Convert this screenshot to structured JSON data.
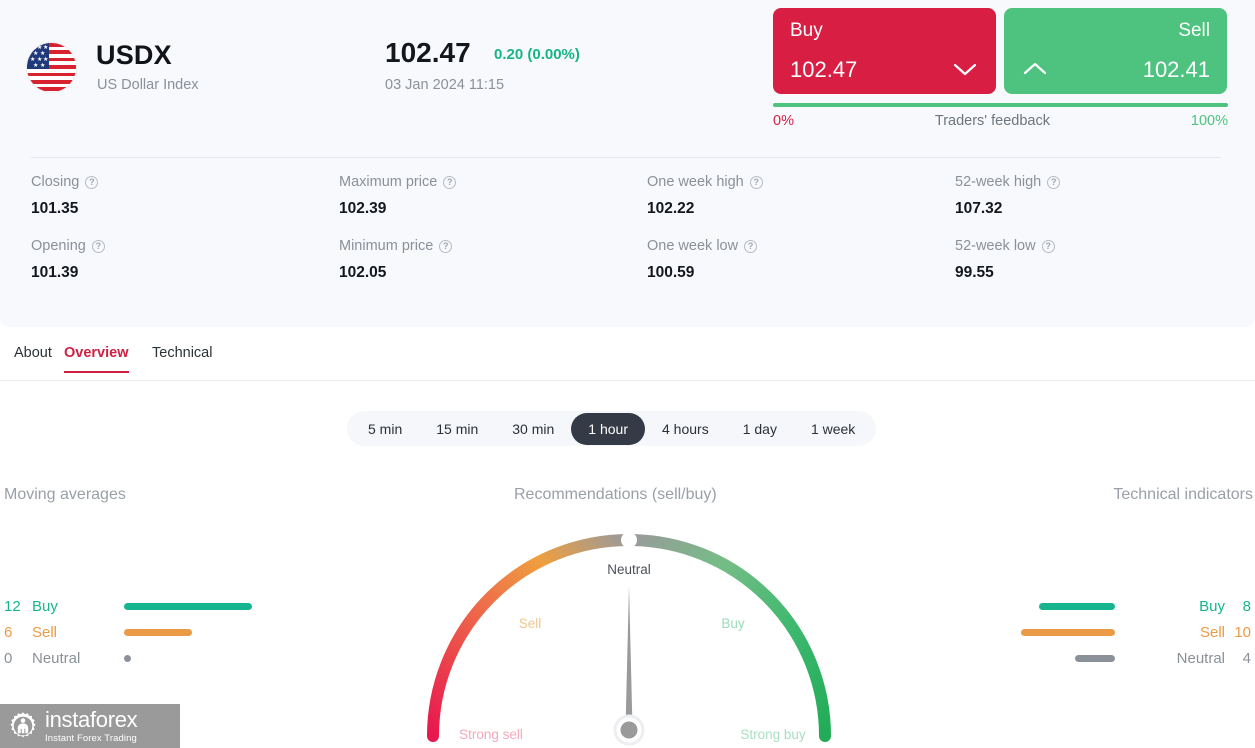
{
  "instrument": {
    "flag_icon": "us-flag-icon",
    "symbol": "USDX",
    "description": "US Dollar Index",
    "price": "102.47",
    "change": "0.20 (0.00%)",
    "timestamp": "03 Jan 2024 11:15"
  },
  "trade": {
    "buy_label": "Buy",
    "buy_price": "102.47",
    "sell_label": "Sell",
    "sell_price": "102.41",
    "buy_color": "#d81e43",
    "sell_color": "#4ec37f",
    "feedback_left": "0%",
    "feedback_title": "Traders' feedback",
    "feedback_right": "100%",
    "feedback_percent": 100
  },
  "stats": [
    {
      "label": "Closing",
      "value": "101.35"
    },
    {
      "label": "Maximum price",
      "value": "102.39"
    },
    {
      "label": "One week high",
      "value": "102.22"
    },
    {
      "label": "52-week high",
      "value": "107.32"
    },
    {
      "label": "Opening",
      "value": "101.39"
    },
    {
      "label": "Minimum price",
      "value": "102.05"
    },
    {
      "label": "One week low",
      "value": "100.59"
    },
    {
      "label": "52-week low",
      "value": "99.55"
    }
  ],
  "tabs": [
    {
      "label": "About",
      "active": false
    },
    {
      "label": "Overview",
      "active": true
    },
    {
      "label": "Technical",
      "active": false
    }
  ],
  "timeframes": [
    {
      "label": "5 min",
      "active": false
    },
    {
      "label": "15 min",
      "active": false
    },
    {
      "label": "30 min",
      "active": false
    },
    {
      "label": "1 hour",
      "active": true
    },
    {
      "label": "4 hours",
      "active": false
    },
    {
      "label": "1 day",
      "active": false
    },
    {
      "label": "1 week",
      "active": false
    }
  ],
  "panels": {
    "moving_averages_title": "Moving averages",
    "recommendations_title": "Recommendations (sell/buy)",
    "technical_indicators_title": "Technical indicators"
  },
  "chart_data": [
    {
      "type": "bar",
      "title": "Moving averages",
      "orientation": "horizontal",
      "categories": [
        "Buy",
        "Sell",
        "Neutral"
      ],
      "values": [
        12,
        6,
        0
      ],
      "colors": [
        "#16b58f",
        "#eb9a45",
        "#8b9199"
      ],
      "xlabel": "",
      "ylabel": "",
      "legend": "none",
      "grid": false
    },
    {
      "type": "gauge",
      "title": "Recommendations (sell/buy)",
      "value": "Neutral",
      "needle_angle_deg": 0,
      "zones": [
        "Strong sell",
        "Sell",
        "Neutral",
        "Buy",
        "Strong buy"
      ],
      "zone_colors": [
        "#e8184f",
        "#ef9a3f",
        "#9a9a9a",
        "#4bbd7a",
        "#27ae5e"
      ],
      "range_labels": {
        "min": "Strong sell",
        "mid": "Neutral",
        "max": "Strong buy"
      }
    },
    {
      "type": "bar",
      "title": "Technical indicators",
      "orientation": "horizontal",
      "categories": [
        "Buy",
        "Sell",
        "Neutral"
      ],
      "values": [
        8,
        10,
        4
      ],
      "colors": [
        "#16b58f",
        "#eb9a45",
        "#8b9199"
      ],
      "xlabel": "",
      "ylabel": "",
      "legend": "none",
      "grid": false
    }
  ],
  "gauge_labels": {
    "neutral": "Neutral",
    "sell": "Sell",
    "buy": "Buy",
    "strong_sell": "Strong sell",
    "strong_buy": "Strong buy"
  },
  "watermark": {
    "brand": "instaforex",
    "tagline": "Instant Forex Trading",
    "icon": "instaforex-gear-icon"
  }
}
